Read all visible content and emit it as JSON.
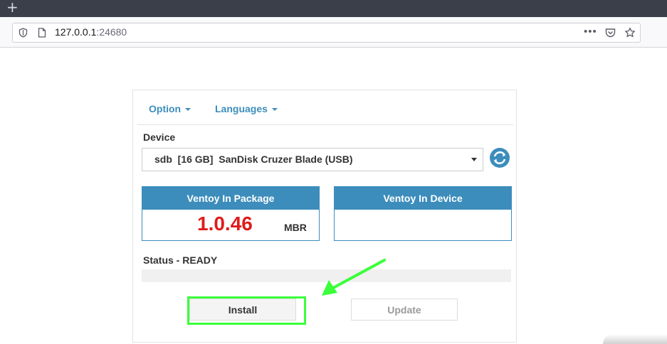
{
  "browser": {
    "url_host": "127.0.0.1",
    "url_port": ":24680"
  },
  "menu": {
    "option_label": "Option",
    "languages_label": "Languages"
  },
  "device": {
    "label": "Device",
    "selected": "sdb  [16 GB]  SanDisk Cruzer Blade (USB)"
  },
  "package": {
    "title": "Ventoy In Package",
    "version": "1.0.46",
    "partition_style": "MBR"
  },
  "device_ventoy": {
    "title": "Ventoy In Device",
    "version": ""
  },
  "status": {
    "label": "Status - READY",
    "progress_percent": 0
  },
  "buttons": {
    "install": "Install",
    "update": "Update"
  },
  "colors": {
    "accent": "#3c8dbc",
    "version_red": "#e01b1b",
    "highlight_green": "#3bff3b"
  },
  "icons": [
    "plus-icon",
    "shield-icon",
    "page-icon",
    "more-icon",
    "pocket-icon",
    "star-icon",
    "refresh-icon"
  ]
}
